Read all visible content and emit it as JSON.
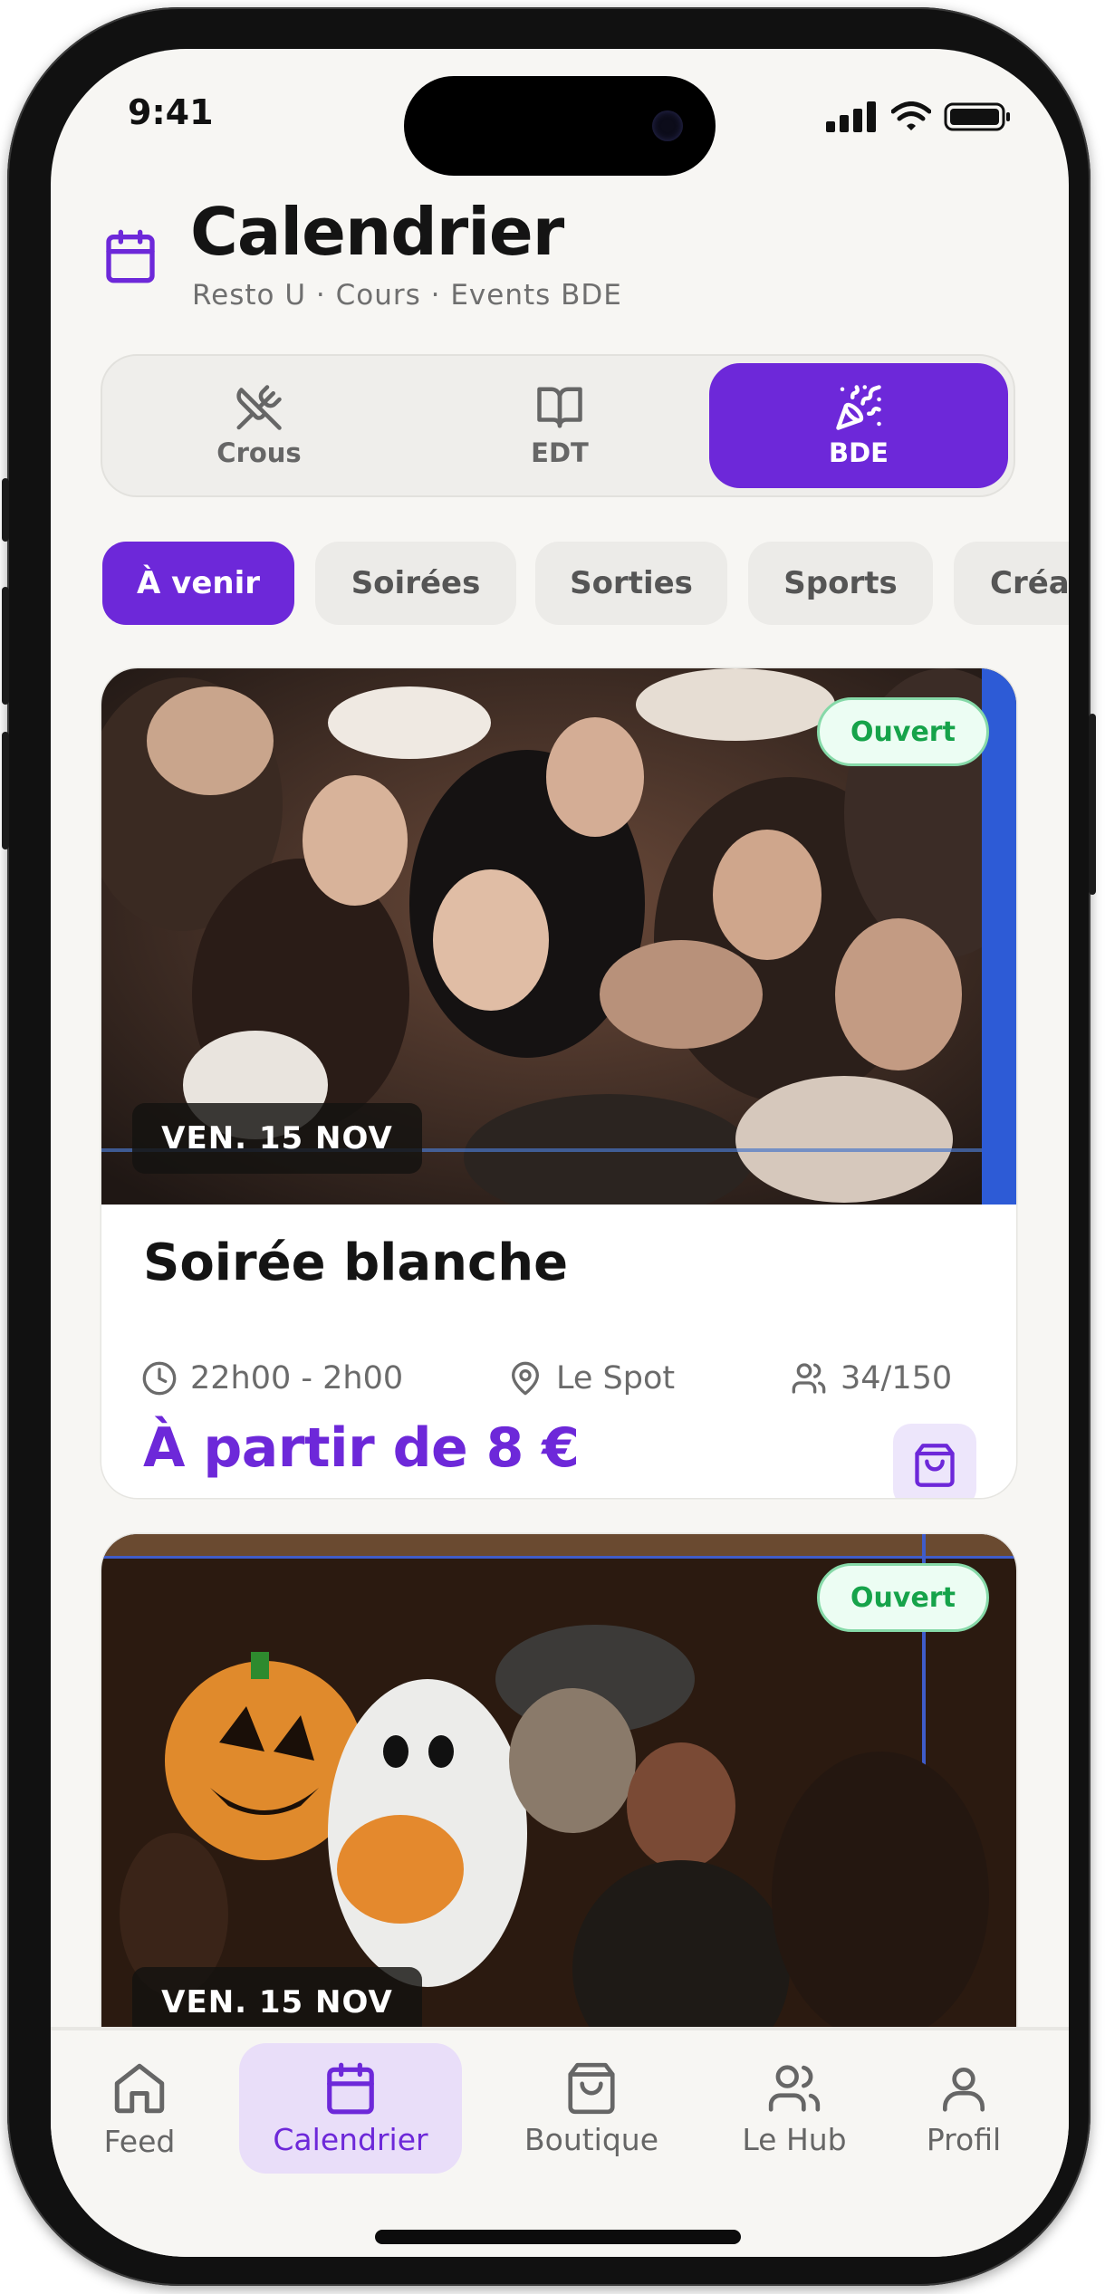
{
  "status_bar": {
    "time": "9:41",
    "icons": [
      "signal-icon",
      "wifi-icon",
      "battery-icon"
    ]
  },
  "header": {
    "icon": "calendar-icon",
    "title": "Calendrier",
    "subtitle": "Resto U · Cours · Events BDE"
  },
  "segments": [
    {
      "label": "Crous",
      "icon": "utensils-crossed-icon",
      "active": false
    },
    {
      "label": "EDT",
      "icon": "book-open-icon",
      "active": false
    },
    {
      "label": "BDE",
      "icon": "party-popper-icon",
      "active": true
    }
  ],
  "filters": [
    {
      "label": "À venir",
      "active": true
    },
    {
      "label": "Soirées",
      "active": false
    },
    {
      "label": "Sorties",
      "active": false
    },
    {
      "label": "Sports",
      "active": false
    },
    {
      "label": "Créa",
      "active": false
    }
  ],
  "events": [
    {
      "status": "Ouvert",
      "date": "VEN. 15 NOV",
      "title": "Soirée blanche",
      "time": "22h00 - 2h00",
      "location": "Le Spot",
      "attendance": "34/150",
      "price": "À partir de 8 €"
    },
    {
      "status": "Ouvert",
      "date": "VEN. 15 NOV"
    }
  ],
  "tab_bar": [
    {
      "label": "Feed",
      "icon": "home-icon",
      "active": false
    },
    {
      "label": "Calendrier",
      "icon": "calendar-icon",
      "active": true
    },
    {
      "label": "Boutique",
      "icon": "shopping-bag-icon",
      "active": false
    },
    {
      "label": "Le Hub",
      "icon": "users-icon",
      "active": false
    },
    {
      "label": "Profil",
      "icon": "user-icon",
      "active": false
    }
  ],
  "colors": {
    "accent": "#6d28d9",
    "accent_soft": "#ede6fb",
    "open_green": "#16a34a",
    "background": "#f7f6f3"
  }
}
